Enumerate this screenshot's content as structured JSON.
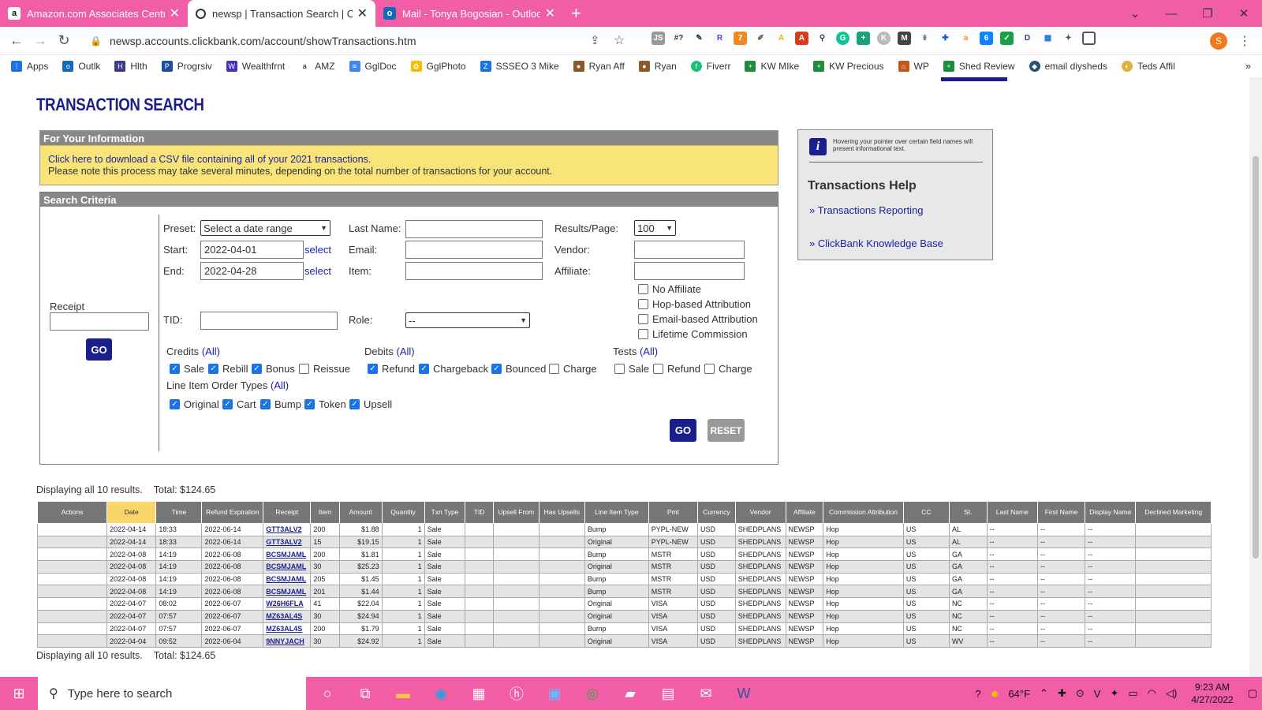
{
  "browser": {
    "tabs": [
      {
        "title": "Amazon.com Associates Central",
        "icon": "amazon-icon",
        "active": false
      },
      {
        "title": "newsp | Transaction Search | Click",
        "icon": "clickbank-icon",
        "active": true
      },
      {
        "title": "Mail - Tonya Bogosian - Outlook",
        "icon": "outlook-icon",
        "active": false
      }
    ],
    "url": "newsp.accounts.clickbank.com/account/showTransactions.htm",
    "profile_initial": "S",
    "bookmarks": [
      "Apps",
      "Outlk",
      "Hlth",
      "Progrsiv",
      "Wealthfrnt",
      "AMZ",
      "GglDoc",
      "GglPhoto",
      "SSSEO 3 Mike",
      "Ryan Aff",
      "Ryan",
      "Fiverr",
      "KW MIke",
      "KW Precious",
      "WP",
      "Shed Review",
      "email diyshe​ds",
      "Teds Affil"
    ]
  },
  "page": {
    "title": "TRANSACTION SEARCH",
    "info": {
      "header": "For Your Information",
      "line1": "Click here to download a CSV file containing all of your 2021 transactions.",
      "line2": "Please note this process may take several minutes, depending on the total number of transactions for your account."
    },
    "criteria": {
      "header": "Search Criteria",
      "receipt_label": "Receipt",
      "go": "GO",
      "reset": "RESET",
      "preset_label": "Preset:",
      "preset_value": "Select a date range",
      "start_label": "Start:",
      "start_value": "2022-04-01",
      "end_label": "End:",
      "end_value": "2022-04-28",
      "select": "select",
      "tid_label": "TID:",
      "lastname_label": "Last Name:",
      "email_label": "Email:",
      "item_label": "Item:",
      "role_label": "Role:",
      "role_value": "--",
      "results_label": "Results/Page:",
      "results_value": "100",
      "vendor_label": "Vendor:",
      "affiliate_label": "Affiliate:",
      "no_affiliate": "No Affiliate",
      "hop": "Hop-based Attribution",
      "email_attr": "Email-based Attribution",
      "lifetime": "Lifetime Commission",
      "credits_label": "Credits",
      "debits_label": "Debits",
      "tests_label": "Tests",
      "all": "(All)",
      "lineitem_label": "Line Item Order Types",
      "credits": [
        {
          "label": "Sale",
          "checked": true
        },
        {
          "label": "Rebill",
          "checked": true
        },
        {
          "label": "Bonus",
          "checked": true
        },
        {
          "label": "Reissue",
          "checked": false
        }
      ],
      "debits": [
        {
          "label": "Refund",
          "checked": true
        },
        {
          "label": "Chargeback",
          "checked": true
        },
        {
          "label": "Bounced",
          "checked": true
        },
        {
          "label": "Charge",
          "checked": false
        }
      ],
      "tests": [
        {
          "label": "Sale",
          "checked": false
        },
        {
          "label": "Refund",
          "checked": false
        },
        {
          "label": "Charge",
          "checked": false
        }
      ],
      "lineitems": [
        {
          "label": "Original",
          "checked": true
        },
        {
          "label": "Cart",
          "checked": true
        },
        {
          "label": "Bump",
          "checked": true
        },
        {
          "label": "Token",
          "checked": true
        },
        {
          "label": "Upsell",
          "checked": true
        }
      ]
    },
    "help": {
      "tip": "Hovering your pointer over certain field names will present informational text.",
      "title": "Transactions Help",
      "link1": "» Transactions Reporting",
      "link2": "» ClickBank Knowledge Base"
    },
    "summary": {
      "displaying": "Displaying all 10 results.",
      "total": "Total: $124.65"
    },
    "table": {
      "headers": [
        "Actions",
        "Date",
        "Time",
        "Refund Expiration",
        "Receipt",
        "Item",
        "Amount",
        "Quantity",
        "Txn Type",
        "TID",
        "Upsell From",
        "Has Upsells",
        "Line Item Type",
        "Pmt",
        "Currency",
        "Vendor",
        "Affiliate",
        "Commission Attribution",
        "CC",
        "St.",
        "Last Name",
        "First Name",
        "Display Name",
        "Declined Marketing"
      ],
      "rows": [
        [
          "",
          "2022-04-14",
          "18:33",
          "2022-06-14",
          "GTT3ALV2",
          "200",
          "$1.88",
          "1",
          "Sale",
          "",
          "",
          "",
          "Bump",
          "PYPL-NEW",
          "USD",
          "SHEDPLANS",
          "NEWSP",
          "Hop",
          "US",
          "AL",
          "--",
          "--",
          "--",
          ""
        ],
        [
          "",
          "2022-04-14",
          "18:33",
          "2022-06-14",
          "GTT3ALV2",
          "15",
          "$19.15",
          "1",
          "Sale",
          "",
          "",
          "",
          "Original",
          "PYPL-NEW",
          "USD",
          "SHEDPLANS",
          "NEWSP",
          "Hop",
          "US",
          "AL",
          "--",
          "--",
          "--",
          ""
        ],
        [
          "",
          "2022-04-08",
          "14:19",
          "2022-06-08",
          "BCSMJAML",
          "200",
          "$1.81",
          "1",
          "Sale",
          "",
          "",
          "",
          "Bump",
          "MSTR",
          "USD",
          "SHEDPLANS",
          "NEWSP",
          "Hop",
          "US",
          "GA",
          "--",
          "--",
          "--",
          ""
        ],
        [
          "",
          "2022-04-08",
          "14:19",
          "2022-06-08",
          "BCSMJAML",
          "30",
          "$25.23",
          "1",
          "Sale",
          "",
          "",
          "",
          "Original",
          "MSTR",
          "USD",
          "SHEDPLANS",
          "NEWSP",
          "Hop",
          "US",
          "GA",
          "--",
          "--",
          "--",
          ""
        ],
        [
          "",
          "2022-04-08",
          "14:19",
          "2022-06-08",
          "BCSMJAML",
          "205",
          "$1.45",
          "1",
          "Sale",
          "",
          "",
          "",
          "Bump",
          "MSTR",
          "USD",
          "SHEDPLANS",
          "NEWSP",
          "Hop",
          "US",
          "GA",
          "--",
          "--",
          "--",
          ""
        ],
        [
          "",
          "2022-04-08",
          "14:19",
          "2022-06-08",
          "BCSMJAML",
          "201",
          "$1.44",
          "1",
          "Sale",
          "",
          "",
          "",
          "Bump",
          "MSTR",
          "USD",
          "SHEDPLANS",
          "NEWSP",
          "Hop",
          "US",
          "GA",
          "--",
          "--",
          "--",
          ""
        ],
        [
          "",
          "2022-04-07",
          "08:02",
          "2022-06-07",
          "W26H6FLA",
          "41",
          "$22.04",
          "1",
          "Sale",
          "",
          "",
          "",
          "Original",
          "VISA",
          "USD",
          "SHEDPLANS",
          "NEWSP",
          "Hop",
          "US",
          "NC",
          "--",
          "--",
          "--",
          ""
        ],
        [
          "",
          "2022-04-07",
          "07:57",
          "2022-06-07",
          "MZ63AL4S",
          "30",
          "$24.94",
          "1",
          "Sale",
          "",
          "",
          "",
          "Original",
          "VISA",
          "USD",
          "SHEDPLANS",
          "NEWSP",
          "Hop",
          "US",
          "NC",
          "--",
          "--",
          "--",
          ""
        ],
        [
          "",
          "2022-04-07",
          "07:57",
          "2022-06-07",
          "MZ63AL4S",
          "200",
          "$1.79",
          "1",
          "Sale",
          "",
          "",
          "",
          "Bump",
          "VISA",
          "USD",
          "SHEDPLANS",
          "NEWSP",
          "Hop",
          "US",
          "NC",
          "--",
          "--",
          "--",
          ""
        ],
        [
          "",
          "2022-04-04",
          "09:52",
          "2022-06-04",
          "9NNYJACH",
          "30",
          "$24.92",
          "1",
          "Sale",
          "",
          "",
          "",
          "Original",
          "VISA",
          "USD",
          "SHEDPLANS",
          "NEWSP",
          "Hop",
          "US",
          "WV",
          "--",
          "--",
          "--",
          ""
        ]
      ]
    }
  },
  "taskbar": {
    "search_placeholder": "Type here to search",
    "weather": "64°F",
    "time": "9:23 AM",
    "date": "4/27/2022"
  }
}
